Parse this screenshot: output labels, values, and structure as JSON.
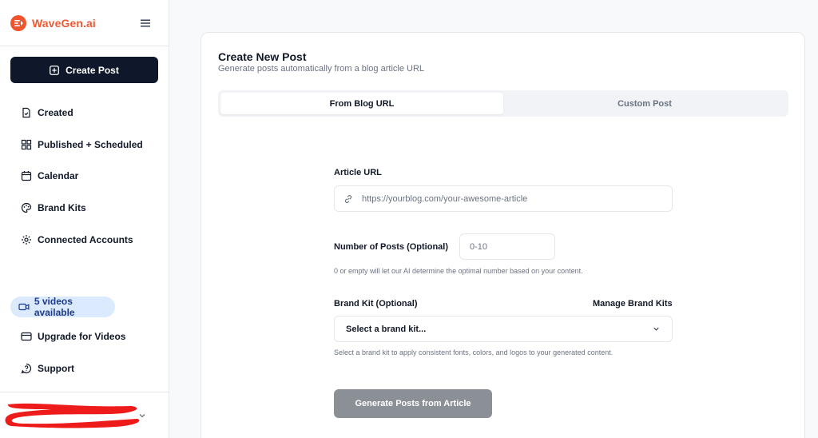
{
  "app": {
    "name": "WaveGen.ai"
  },
  "sidebar": {
    "create_label": "Create Post",
    "items": [
      {
        "label": "Created",
        "icon": "file-check-icon"
      },
      {
        "label": "Published + Scheduled",
        "icon": "grid-icon"
      },
      {
        "label": "Calendar",
        "icon": "calendar-icon"
      },
      {
        "label": "Brand Kits",
        "icon": "palette-icon"
      },
      {
        "label": "Connected Accounts",
        "icon": "gear-icon"
      }
    ],
    "videos_badge": "5 videos available",
    "upgrade_label": "Upgrade for Videos",
    "support_label": "Support"
  },
  "main": {
    "title": "Create New Post",
    "subtitle": "Generate posts automatically from a blog article URL",
    "tabs": [
      {
        "label": "From Blog URL",
        "active": true
      },
      {
        "label": "Custom Post",
        "active": false
      }
    ],
    "form": {
      "article_url_label": "Article URL",
      "article_url_placeholder": "https://yourblog.com/your-awesome-article",
      "num_posts_label": "Number of Posts (Optional)",
      "num_posts_placeholder": "0-10",
      "num_posts_help": "0 or empty will let our AI determine the optimal number based on your content.",
      "brand_kit_label": "Brand Kit (Optional)",
      "manage_brand_kits": "Manage Brand Kits",
      "brand_kit_select": "Select a brand kit...",
      "brand_kit_help": "Select a brand kit to apply consistent fonts, colors, and logos to your generated content.",
      "submit_label": "Generate Posts from Article"
    }
  },
  "colors": {
    "brand": "#ef5a35",
    "primary_button": "#0f172a",
    "badge_bg": "#dbeafe",
    "disabled_button": "#8b8f96"
  }
}
